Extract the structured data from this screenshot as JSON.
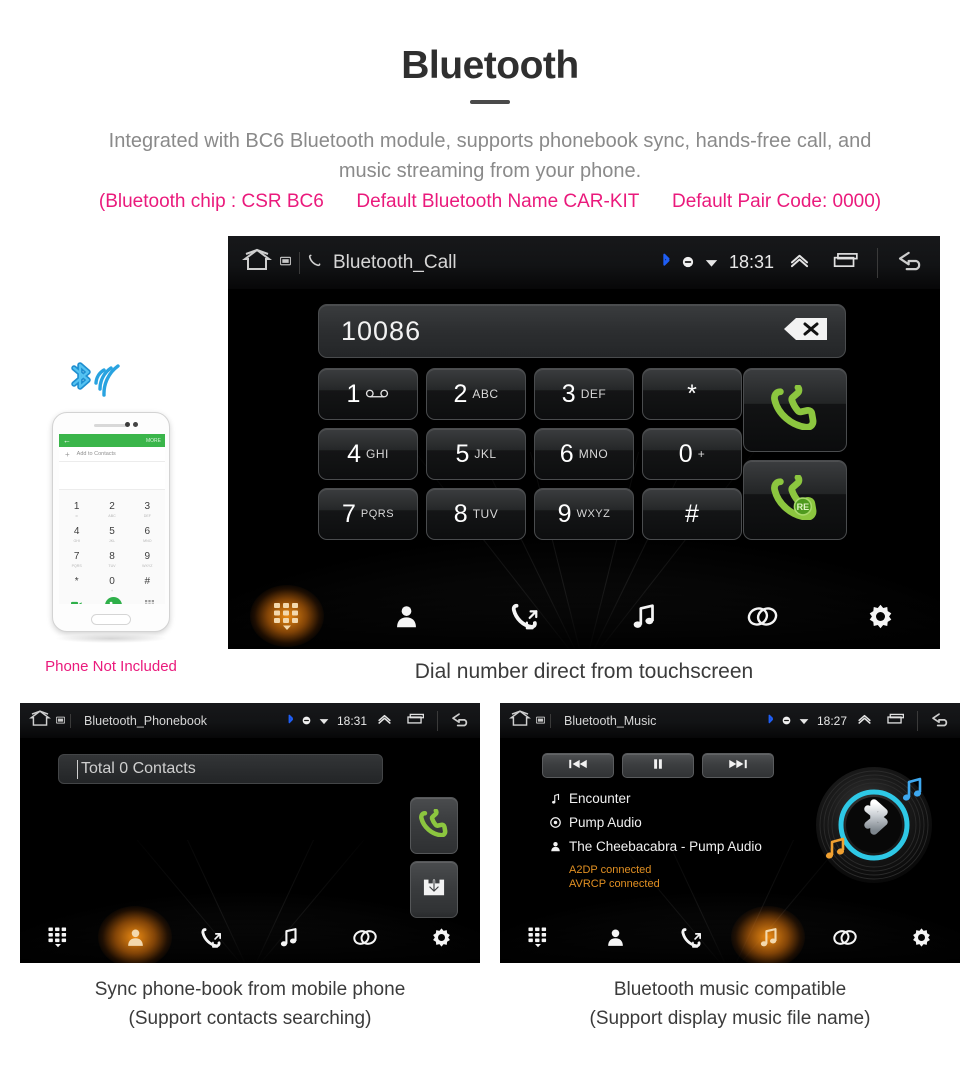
{
  "header": {
    "title": "Bluetooth",
    "subtitle_line1": "Integrated with BC6 Bluetooth module, supports phonebook sync, hands-free call, and",
    "subtitle_line2": "music streaming from your phone.",
    "spec_chip": "(Bluetooth chip : CSR BC6",
    "spec_name": "Default Bluetooth Name CAR-KIT",
    "spec_pair": "Default Pair Code: 0000)",
    "accent_color": "#ea1a7c",
    "title_color": "#2f2f2f",
    "subtitle_color": "#8a8a8a"
  },
  "call_panel": {
    "statusbar": {
      "home_icon": "home-icon",
      "screen_icon": "screen-icon",
      "phone_icon": "phone-handset-icon",
      "title": "Bluetooth_Call",
      "bluetooth_icon": "bluetooth-icon",
      "mute_icon": "mute-icon",
      "wifi_icon": "wifi-icon",
      "time": "18:31",
      "expand_icon": "chevron-up-icon",
      "recents_icon": "recents-icon",
      "back_icon": "back-arrow-icon"
    },
    "number_display": {
      "value": "10086",
      "backspace_icon": "backspace-icon"
    },
    "keys": [
      {
        "digit": "1",
        "sub": "∞",
        "sub_kind": "voicemail"
      },
      {
        "digit": "2",
        "sub": "ABC",
        "sub_kind": "letters"
      },
      {
        "digit": "3",
        "sub": "DEF",
        "sub_kind": "letters"
      },
      {
        "digit": "*",
        "sub": "",
        "sub_kind": "symbol"
      },
      {
        "digit": "4",
        "sub": "GHI",
        "sub_kind": "letters"
      },
      {
        "digit": "5",
        "sub": "JKL",
        "sub_kind": "letters"
      },
      {
        "digit": "6",
        "sub": "MNO",
        "sub_kind": "letters"
      },
      {
        "digit": "0",
        "sub": "+",
        "sub_kind": "plus"
      },
      {
        "digit": "7",
        "sub": "PQRS",
        "sub_kind": "letters"
      },
      {
        "digit": "8",
        "sub": "TUV",
        "sub_kind": "letters"
      },
      {
        "digit": "9",
        "sub": "WXYZ",
        "sub_kind": "letters"
      },
      {
        "digit": "#",
        "sub": "",
        "sub_kind": "symbol"
      }
    ],
    "call_button_icon": "call-handset-icon",
    "redial_button_icon": "redial-handset-icon",
    "redial_badge": "RE",
    "call_green": "#8cc63f",
    "nav": [
      {
        "icon": "dialpad-icon",
        "label": "Dialpad",
        "active": true
      },
      {
        "icon": "contacts-icon",
        "label": "Contacts",
        "active": false
      },
      {
        "icon": "call-history-icon",
        "label": "Call history",
        "active": false
      },
      {
        "icon": "music-note-icon",
        "label": "Music",
        "active": false
      },
      {
        "icon": "link-icon",
        "label": "Pair",
        "active": false
      },
      {
        "icon": "gear-icon",
        "label": "Settings",
        "active": false
      }
    ],
    "caption": "Dial number direct from touchscreen"
  },
  "phone_illustration": {
    "appbar_back_icon": "back-arrow-icon",
    "appbar_more": "MORE",
    "add_contact_plus": "+",
    "add_contact_label": "Add to Contacts",
    "keys": [
      {
        "digit": "1",
        "sub": "∞"
      },
      {
        "digit": "2",
        "sub": "ABC"
      },
      {
        "digit": "3",
        "sub": "DEF"
      },
      {
        "digit": "4",
        "sub": "GHI"
      },
      {
        "digit": "5",
        "sub": "JKL"
      },
      {
        "digit": "6",
        "sub": "MNO"
      },
      {
        "digit": "7",
        "sub": "PQRS"
      },
      {
        "digit": "8",
        "sub": "TUV"
      },
      {
        "digit": "9",
        "sub": "WXYZ"
      },
      {
        "digit": "*",
        "sub": ""
      },
      {
        "digit": "0",
        "sub": "+"
      },
      {
        "digit": "#",
        "sub": ""
      }
    ],
    "video_call_icon": "video-call-icon",
    "call_icon": "call-handset-icon",
    "keypad_toggle_icon": "keypad-icon",
    "bluetooth_signal_icon": "bluetooth-signal-icon",
    "bluetooth_color": "#1b9ad6",
    "note": "Phone Not Included"
  },
  "phonebook_panel": {
    "statusbar": {
      "home_icon": "home-icon",
      "screen_icon": "screen-icon",
      "title": "Bluetooth_Phonebook",
      "bluetooth_icon": "bluetooth-icon",
      "mute_icon": "mute-icon",
      "wifi_icon": "wifi-icon",
      "time": "18:31",
      "expand_icon": "chevron-up-icon",
      "recents_icon": "recents-icon",
      "back_icon": "back-arrow-icon"
    },
    "search_placeholder": "Total 0 Contacts",
    "call_button_icon": "call-handset-icon",
    "sync_button_icon": "download-sync-icon",
    "nav": [
      {
        "icon": "dialpad-icon",
        "label": "Dialpad",
        "active": false
      },
      {
        "icon": "contacts-icon",
        "label": "Contacts",
        "active": true
      },
      {
        "icon": "call-history-icon",
        "label": "Call history",
        "active": false
      },
      {
        "icon": "music-note-icon",
        "label": "Music",
        "active": false
      },
      {
        "icon": "link-icon",
        "label": "Pair",
        "active": false
      },
      {
        "icon": "gear-icon",
        "label": "Settings",
        "active": false
      }
    ],
    "caption_line1": "Sync phone-book from mobile phone",
    "caption_line2": "(Support contacts searching)"
  },
  "music_panel": {
    "statusbar": {
      "home_icon": "home-icon",
      "screen_icon": "screen-icon",
      "title": "Bluetooth_Music",
      "bluetooth_icon": "bluetooth-icon",
      "mute_icon": "mute-icon",
      "wifi_icon": "wifi-icon",
      "time": "18:27",
      "expand_icon": "chevron-up-icon",
      "recents_icon": "recents-icon",
      "back_icon": "back-arrow-icon"
    },
    "transport": [
      {
        "icon": "previous-track-icon",
        "label": "Previous"
      },
      {
        "icon": "pause-icon",
        "label": "Pause"
      },
      {
        "icon": "next-track-icon",
        "label": "Next"
      }
    ],
    "track_title": "Encounter",
    "album": "Pump Audio",
    "artist": "The Cheebacabra - Pump Audio",
    "status_a2dp": "A2DP connected",
    "status_avrcp": "AVRCP connected",
    "status_color": "#e08f22",
    "disc_icon": "bluetooth-vinyl-disc-icon",
    "disc_ring_color": "#2ec8e6",
    "nav": [
      {
        "icon": "dialpad-icon",
        "label": "Dialpad",
        "active": false
      },
      {
        "icon": "contacts-icon",
        "label": "Contacts",
        "active": false
      },
      {
        "icon": "call-history-icon",
        "label": "Call history",
        "active": false
      },
      {
        "icon": "music-note-icon",
        "label": "Music",
        "active": true
      },
      {
        "icon": "link-icon",
        "label": "Pair",
        "active": false
      },
      {
        "icon": "gear-icon",
        "label": "Settings",
        "active": false
      }
    ],
    "caption_line1": "Bluetooth music compatible",
    "caption_line2": "(Support display music file name)"
  }
}
